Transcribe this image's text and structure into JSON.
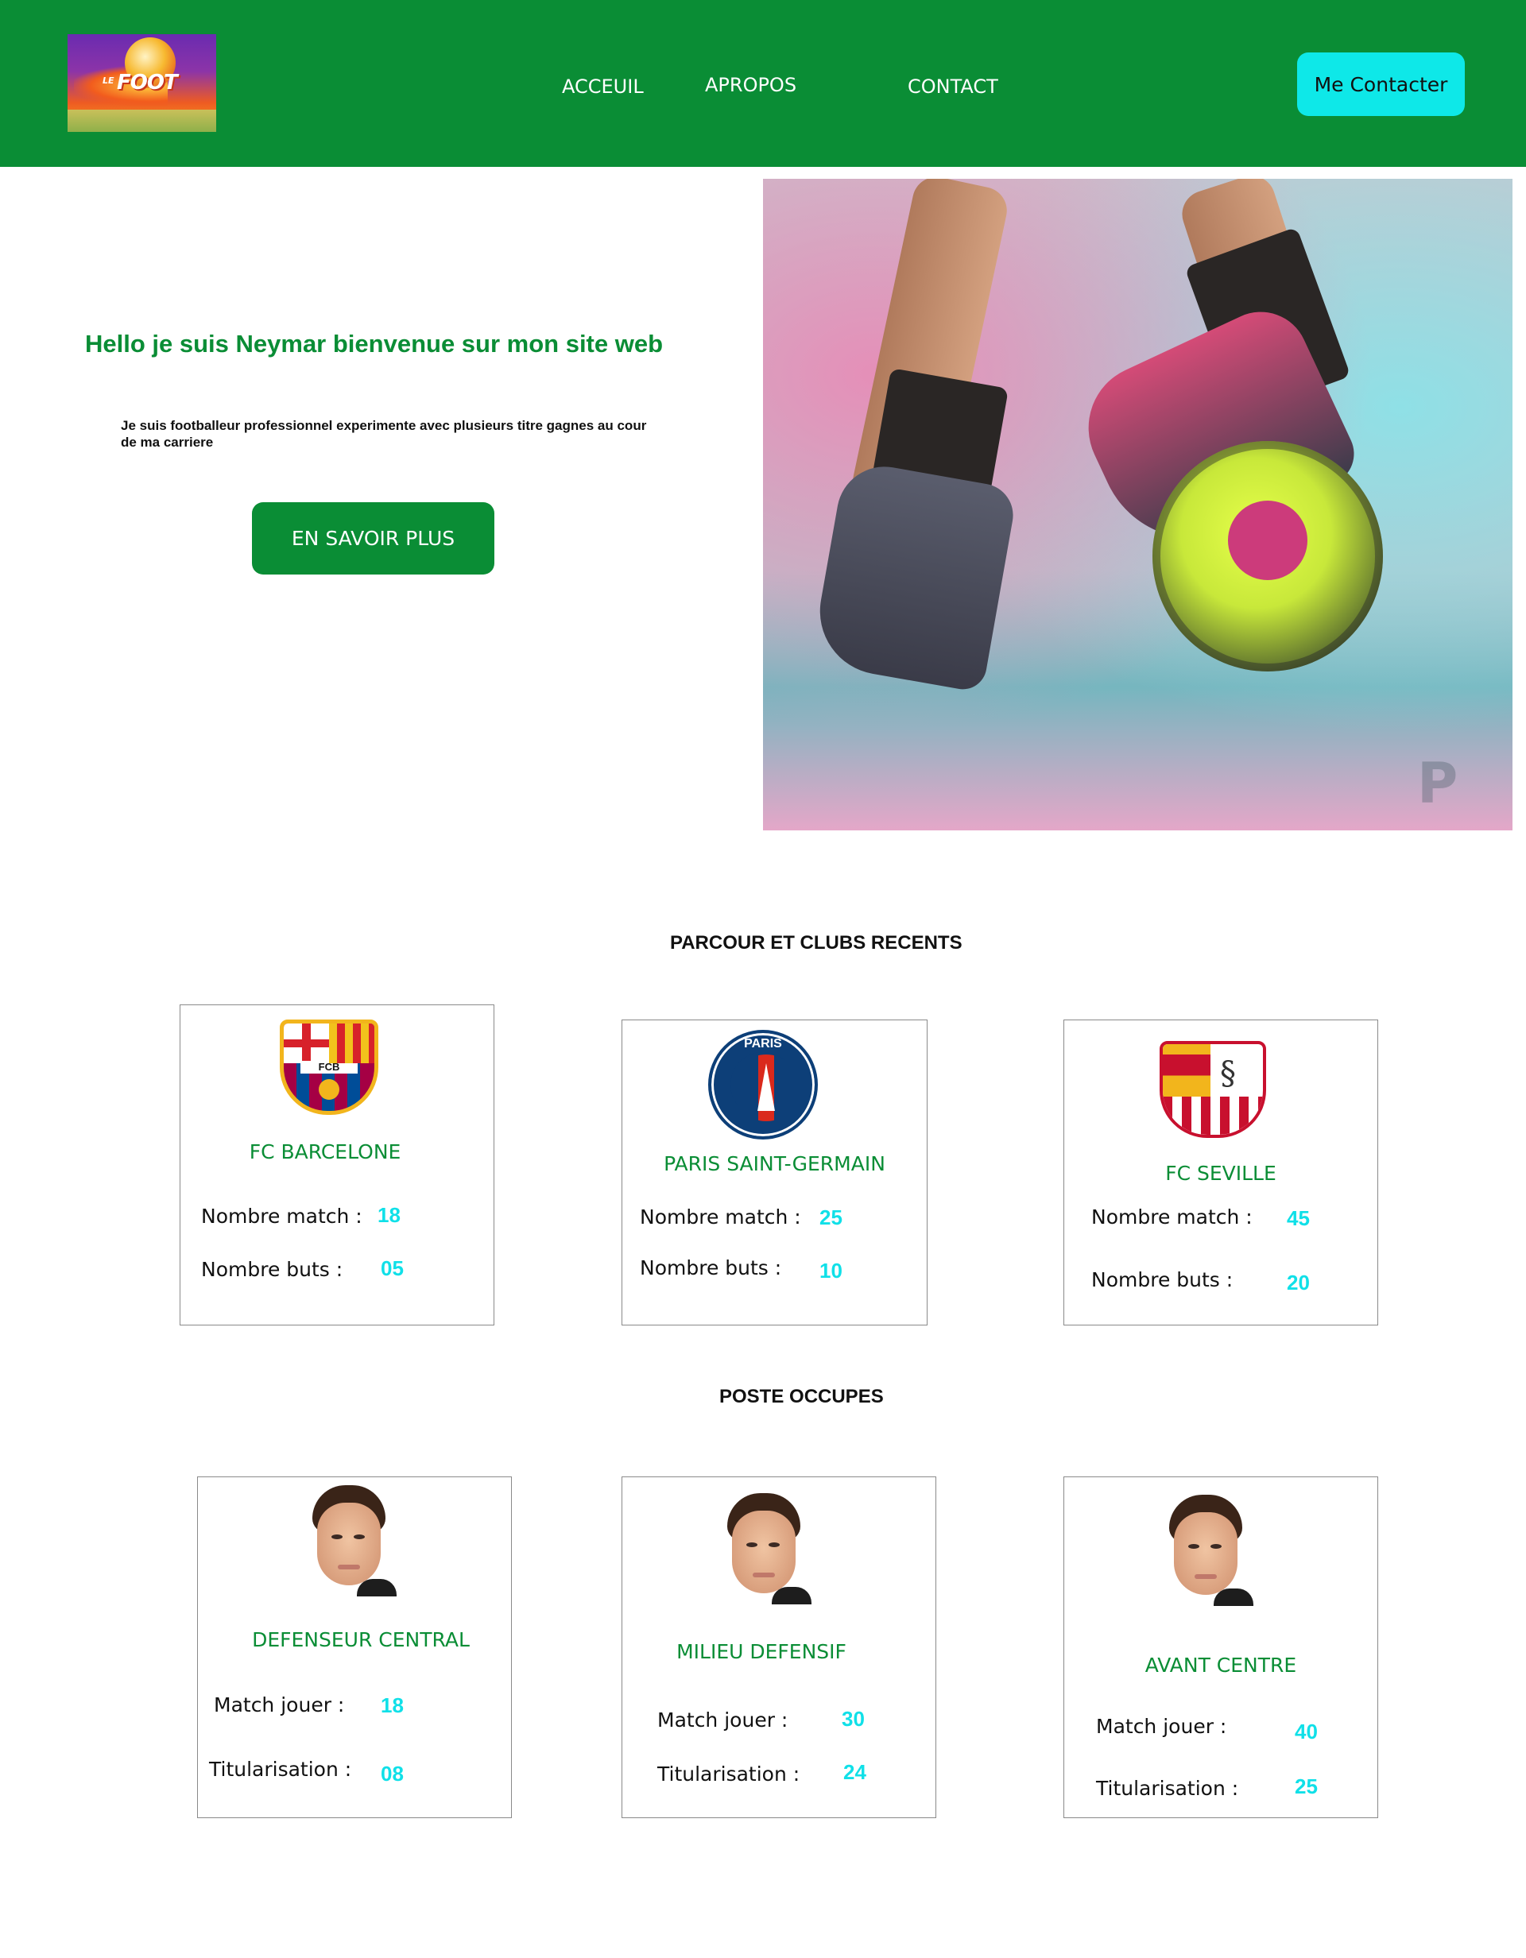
{
  "header": {
    "logo": {
      "small_text": "LE",
      "main_text": "FOOT"
    },
    "nav": [
      {
        "label": "ACCEUIL"
      },
      {
        "label": "APROPOS"
      },
      {
        "label": "CONTACT"
      }
    ],
    "contact_button": "Me Contacter",
    "background_color": "#0a8d35",
    "accent_color": "#0ee8e8"
  },
  "hero": {
    "title": "Hello je suis Neymar bienvenue sur mon site web",
    "text": "Je suis footballeur professionnel experimente avec plusieurs titre gagnes au cour de ma carriere",
    "button": "EN SAVOIR PLUS",
    "image": "footballer-kicking-ball-photo"
  },
  "clubs_section": {
    "title": "PARCOUR ET CLUBS RECENTS",
    "clubs": [
      {
        "name": "FC BARCELONE",
        "crest": "barcelona-crest-icon",
        "match_label": "Nombre match :",
        "match": "18",
        "goals_label": "Nombre buts :",
        "goals": "05"
      },
      {
        "name": "PARIS SAINT-GERMAIN",
        "crest": "psg-crest-icon",
        "match_label": "Nombre match :",
        "match": "25",
        "goals_label": "Nombre buts :",
        "goals": "10"
      },
      {
        "name": "FC SEVILLE",
        "crest": "sevilla-crest-icon",
        "match_label": "Nombre match :",
        "match": "45",
        "goals_label": "Nombre buts :",
        "goals": "20"
      }
    ]
  },
  "positions_section": {
    "title": "POSTE OCCUPES",
    "positions": [
      {
        "name": "DEFENSEUR CENTRAL",
        "match_label": "Match jouer :",
        "match": "18",
        "starts_label": "Titularisation :",
        "starts": "08"
      },
      {
        "name": "MILIEU DEFENSIF",
        "match_label": "Match jouer :",
        "match": "30",
        "starts_label": "Titularisation :",
        "starts": "24"
      },
      {
        "name": "AVANT CENTRE",
        "match_label": "Match jouer :",
        "match": "40",
        "starts_label": "Titularisation :",
        "starts": "25"
      }
    ]
  }
}
